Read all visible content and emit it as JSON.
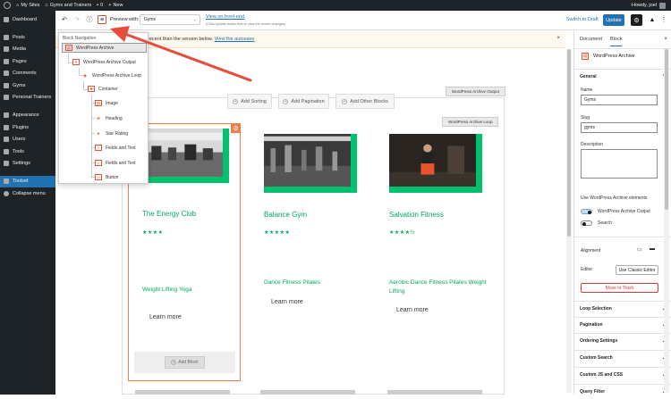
{
  "adminbar": {
    "my_sites": "My Sites",
    "site_name": "Gyms and Trainers",
    "comments_count": "0",
    "new_label": "New",
    "howdy": "Howdy, joel"
  },
  "sidebar": {
    "items": [
      {
        "label": "Dashboard",
        "icon": "dashboard-icon"
      },
      {
        "label": "Posts",
        "icon": "pin-icon"
      },
      {
        "label": "Media",
        "icon": "media-icon"
      },
      {
        "label": "Pages",
        "icon": "page-icon"
      },
      {
        "label": "Comments",
        "icon": "comment-icon"
      },
      {
        "label": "Gyms",
        "icon": "gym-icon"
      },
      {
        "label": "Personal Trainers",
        "icon": "trainer-icon"
      },
      {
        "label": "Appearance",
        "icon": "brush-icon"
      },
      {
        "label": "Plugins",
        "icon": "plug-icon"
      },
      {
        "label": "Users",
        "icon": "user-icon"
      },
      {
        "label": "Tools",
        "icon": "wrench-icon"
      },
      {
        "label": "Settings",
        "icon": "settings-icon"
      },
      {
        "label": "Toolset",
        "icon": "toolset-icon"
      },
      {
        "label": "Collapse menu",
        "icon": "collapse-icon"
      }
    ]
  },
  "toolbar": {
    "undo": "↶",
    "redo": "↷",
    "info": "ⓘ",
    "nav": "≡",
    "preview_label": "Preview with:",
    "preview_value": "Gyms",
    "frontend_link": "View on front-end",
    "frontend_hint": "(Click Update button first to view the recent changes)",
    "save_draft": "Switch to Draft",
    "update": "Update",
    "more": "⋮"
  },
  "notice": {
    "text": "recent than the version below.",
    "link": "View the autosave"
  },
  "block_nav": {
    "header": "Block Navigation",
    "items": [
      {
        "label": "WordPress Archive",
        "icon": "archive-block-icon"
      },
      {
        "label": "WordPress Archive Output",
        "icon": "output-block-icon"
      },
      {
        "label": "WordPress Archive Loop",
        "icon": "loop-block-icon"
      },
      {
        "label": "Container",
        "icon": "container-block-icon"
      },
      {
        "label": "Image",
        "icon": "image-block-icon"
      },
      {
        "label": "Heading",
        "icon": "heading-block-icon"
      },
      {
        "label": "Star Rating",
        "icon": "star-block-icon"
      },
      {
        "label": "Fields and Text",
        "icon": "fields-block-icon"
      },
      {
        "label": "Fields and Text",
        "icon": "fields-block-icon"
      },
      {
        "label": "Button",
        "icon": "button-block-icon"
      }
    ]
  },
  "content": {
    "archive_output_tag": "WordPress Archive Output",
    "archive_loop_tag": "WordPress Archive Loop",
    "add_sorting": "Add Sorting",
    "add_pagination": "Add Pagination",
    "add_other": "Add Other Blocks",
    "add_block": "Add Block",
    "cards": [
      {
        "title": "The Energy Club",
        "rating": 4,
        "stars": "★★★★",
        "tags": "Weight Lifting  Yoga",
        "learn": "Learn more"
      },
      {
        "title": "Balance Gym",
        "rating": 5,
        "stars": "★★★★★",
        "tags": "Dance  Fitness  Pilates",
        "learn": "Learn more"
      },
      {
        "title": "Salvation Fitness",
        "rating": 4.5,
        "stars": "★★★★½",
        "tags": "Aerobic  Dance  Fitness  Pilates  Weight Lifting",
        "learn": "Learn more"
      }
    ]
  },
  "right_panel": {
    "tab_document": "Document",
    "tab_block": "Block",
    "close": "×",
    "block_title": "WordPress Archive",
    "general": "General",
    "name_label": "Name",
    "name_value": "Gyms",
    "slug_label": "Slug",
    "slug_value": "gyms",
    "description_label": "Description",
    "use_elements": "Use WordPress Archive elements",
    "toggle_output": "WordPress Archive Output",
    "toggle_search": "Search",
    "alignment": "Alignment",
    "editor": "Editor",
    "classic_editor": "Use Classic Editor",
    "trash": "Move to Trash",
    "sections": [
      "Loop Selection",
      "Pagination",
      "Ordering Settings",
      "Custom Search",
      "Custom JS and CSS",
      "Query Filter"
    ]
  },
  "colors": {
    "accent": "#2271b1",
    "brand_green": "#00a862",
    "selected_outline": "#e8814f",
    "arrow": "#e74c3c"
  }
}
